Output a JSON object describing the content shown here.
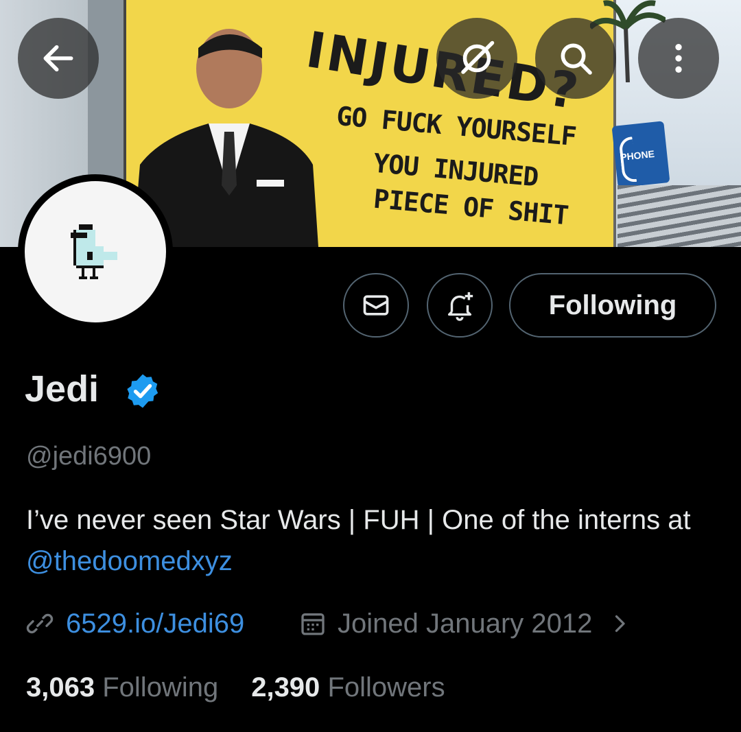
{
  "banner": {
    "headline": "INJURED?",
    "line1": "GO FUCK YOURSELF",
    "line2": "YOU INJURED",
    "line3": "PIECE OF SHIT",
    "phone_sign": "PHONE"
  },
  "header": {
    "back_icon": "arrow-left-icon",
    "grok_icon": "grok-icon",
    "search_icon": "search-icon",
    "more_icon": "more-vertical-icon"
  },
  "profile": {
    "name": "Jedi",
    "handle": "@jedi6900",
    "bio_text": "I’ve never seen Star Wars | FUH | One of the interns at ",
    "bio_mention": "@thedoomedxyz",
    "website": "6529.io/Jedi69",
    "joined": "Joined January 2012",
    "following_count": "3,063",
    "following_label": "Following",
    "followers_count": "2,390",
    "followers_label": "Followers"
  },
  "actions": {
    "message_icon": "envelope-icon",
    "notify_icon": "bell-plus-icon",
    "follow_label": "Following"
  },
  "colors": {
    "background": "#000000",
    "link": "#3d8fe0",
    "muted": "#71767b",
    "verified": "#1d9bf0",
    "billboard": "#f2d64a"
  }
}
